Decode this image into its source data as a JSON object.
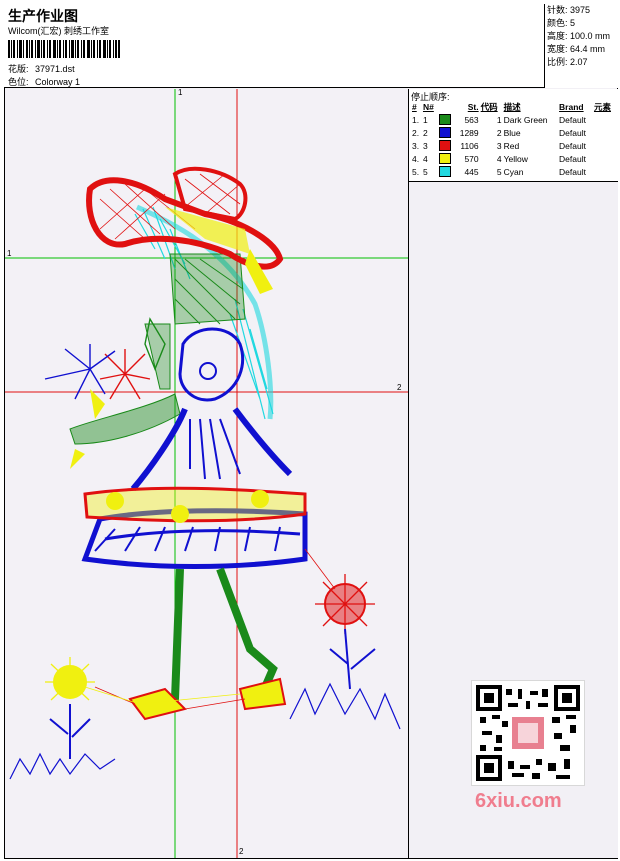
{
  "header": {
    "title": "生产作业图",
    "subtitle": "Wilcom(汇宏) 刺绣工作室",
    "design_label": "花版:",
    "design_value": "37971.dst",
    "colorway_label": "色位:",
    "colorway_value": "Colorway 1"
  },
  "stats": [
    {
      "label": "针数",
      "value": "3975"
    },
    {
      "label": "颜色",
      "value": "5"
    },
    {
      "label": "高度",
      "value": "100.0 mm"
    },
    {
      "label": "宽度",
      "value": "64.4 mm"
    },
    {
      "label": "比例",
      "value": "2.07"
    }
  ],
  "stop_sequence": {
    "title": "停止顺序:",
    "headers": [
      "#",
      "N#",
      "St.",
      "代码",
      "描述",
      "Brand",
      "元素"
    ],
    "rows": [
      {
        "n": "1.",
        "nn": "1",
        "color": "#1a8a1a",
        "st": "563",
        "code": "1",
        "desc": "Dark Green",
        "brand": "Default"
      },
      {
        "n": "2.",
        "nn": "2",
        "color": "#1010d0",
        "st": "1289",
        "code": "2",
        "desc": "Blue",
        "brand": "Default"
      },
      {
        "n": "3.",
        "nn": "3",
        "color": "#e01010",
        "st": "1106",
        "code": "3",
        "desc": "Red",
        "brand": "Default"
      },
      {
        "n": "4.",
        "nn": "4",
        "color": "#f0f010",
        "st": "570",
        "code": "4",
        "desc": "Yellow",
        "brand": "Default"
      },
      {
        "n": "5.",
        "nn": "5",
        "color": "#20d8e0",
        "st": "445",
        "code": "5",
        "desc": "Cyan",
        "brand": "Default"
      }
    ]
  },
  "axes": {
    "v1": "1",
    "h1": "1",
    "h2": "2",
    "v2": "2"
  },
  "watermark": "6xiu.com",
  "colors": {
    "green": "#1a8a1a",
    "blue": "#1010d0",
    "red": "#e01010",
    "yellow": "#f0f010",
    "cyan": "#20d8e0"
  }
}
